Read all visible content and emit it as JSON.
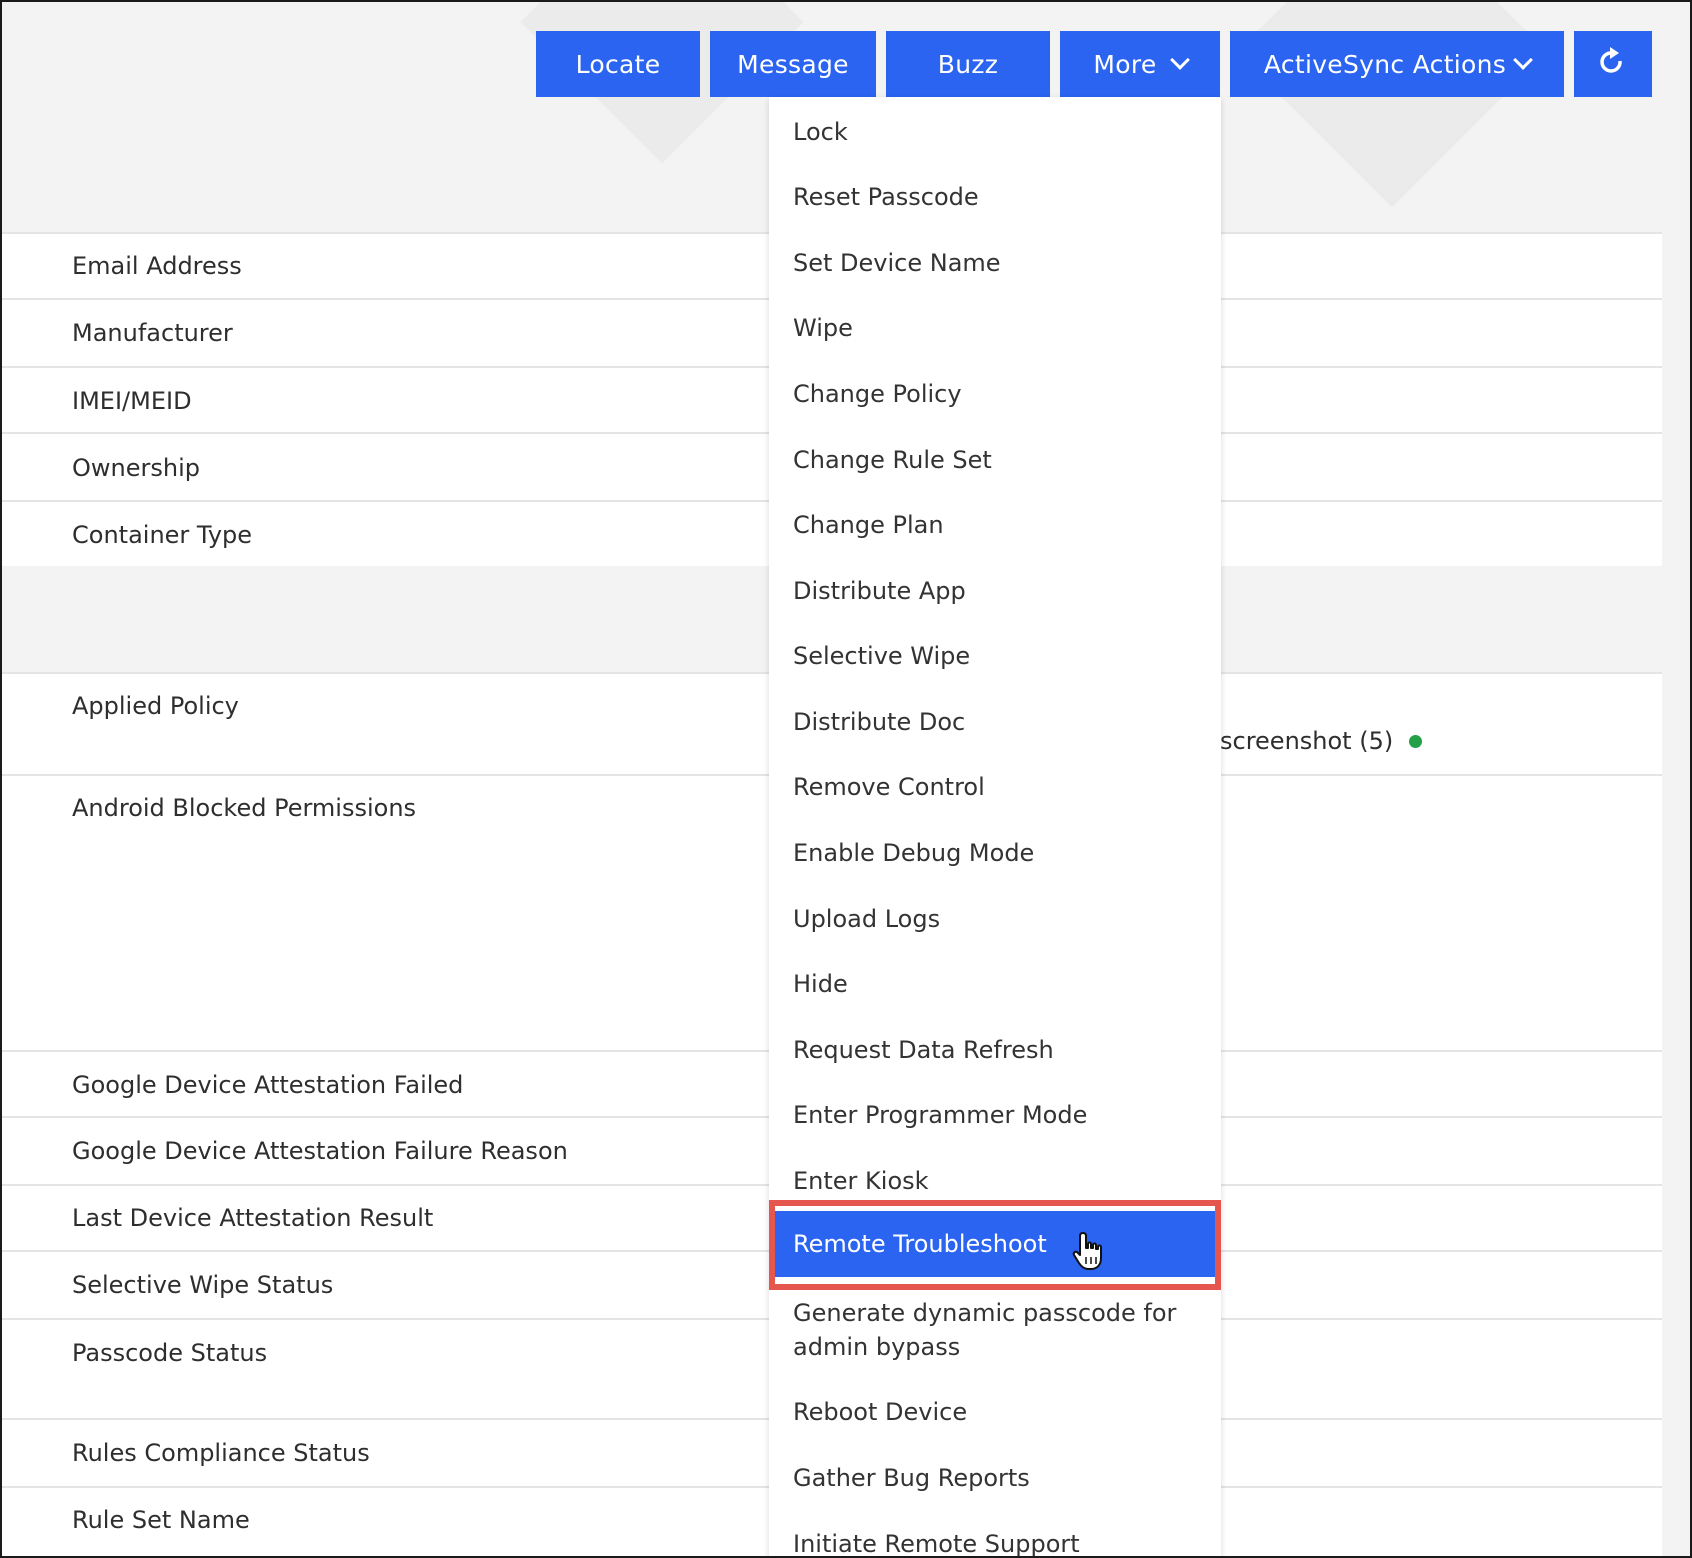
{
  "toolbar": {
    "locate": "Locate",
    "message": "Message",
    "buzz": "Buzz",
    "more": "More",
    "activesync": "ActiveSync Actions"
  },
  "fields": [
    "Email Address",
    "Manufacturer",
    "IMEI/MEID",
    "Ownership",
    "Container Type",
    "Applied Policy",
    "Android Blocked Permissions",
    "Google Device Attestation Failed",
    "Google Device Attestation Failure Reason",
    "Last Device Attestation Result",
    "Selective Wipe Status",
    "Passcode Status",
    "Rules Compliance Status",
    "Rule Set Name"
  ],
  "applied_policy_value": "screenshot (5)",
  "menu": {
    "items": [
      "Lock",
      "Reset Passcode",
      "Set Device Name",
      "Wipe",
      "Change Policy",
      "Change Rule Set",
      "Change Plan",
      "Distribute App",
      "Selective Wipe",
      "Distribute Doc",
      "Remove Control",
      "Enable Debug Mode",
      "Upload Logs",
      "Hide",
      "Request Data Refresh",
      "Enter Programmer Mode",
      "Enter Kiosk",
      "Remote Troubleshoot",
      "Generate dynamic passcode for",
      "admin bypass",
      "Reboot Device",
      "Gather Bug Reports",
      "Initiate Remote Support"
    ]
  },
  "colors": {
    "button_blue": "#2a64f0",
    "highlight_red": "#e5564f",
    "status_green": "#24a148"
  }
}
